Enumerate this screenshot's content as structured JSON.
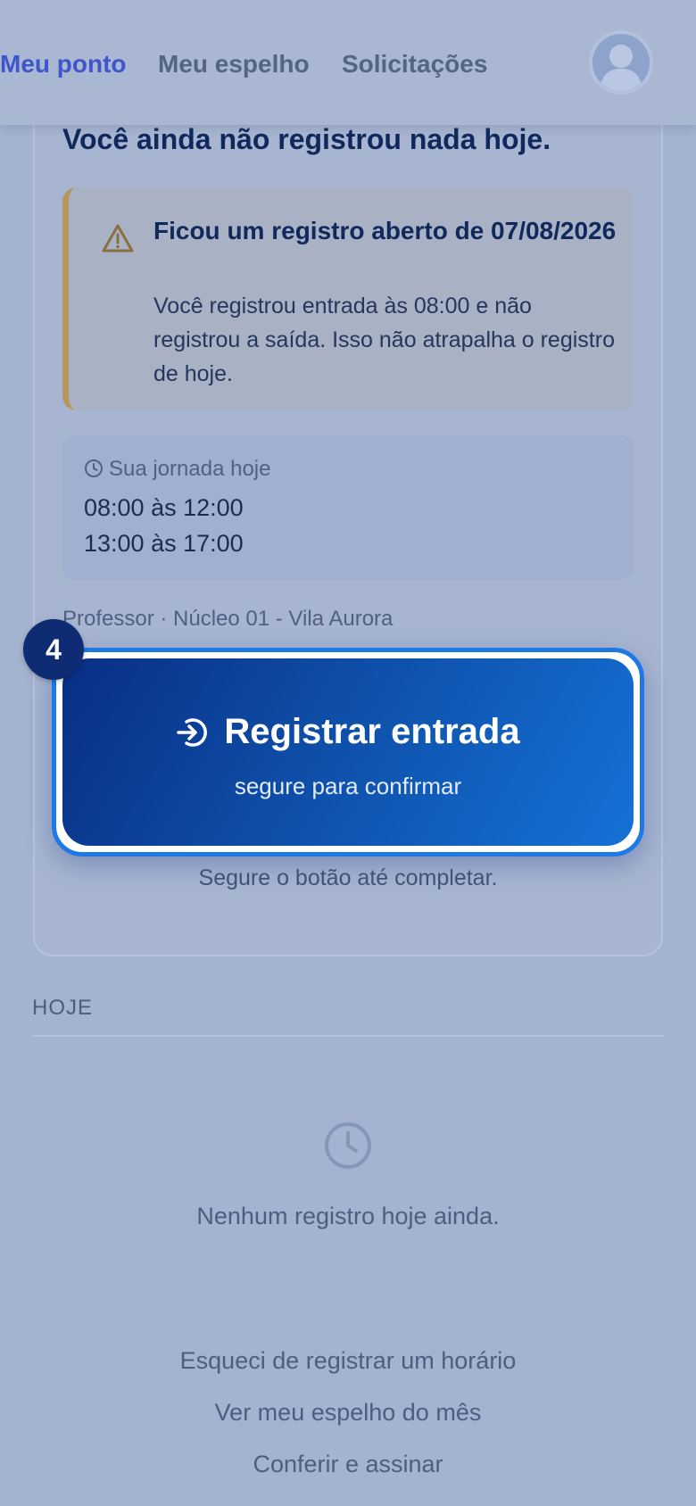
{
  "nav": {
    "tabs": [
      "Meu ponto",
      "Meu espelho",
      "Solicitações"
    ],
    "active_tab": "Meu ponto"
  },
  "card": {
    "title": "Você ainda não registrou nada hoje.",
    "warning": {
      "title": "Ficou um registro aberto de 07/08/2026",
      "text": "Você registrou entrada às 08:00 e não registrou a saída. Isso não atrapalha o registro de hoje.",
      "icon": "warning-triangle-icon"
    },
    "shift": {
      "heading": "Sua jornada hoje",
      "icon": "clock-icon",
      "periods": [
        "08:00 às 12:00",
        "13:00 às 17:00"
      ]
    },
    "role_line": "Professor · Núcleo 01 - Vila Aurora",
    "button": {
      "label": "Registrar entrada",
      "sublabel": "segure para confirmar",
      "icon": "sign-in-icon"
    },
    "step_badge": "4",
    "hold_hint": "Segure o botão até completar."
  },
  "today": {
    "section_label": "HOJE",
    "empty_text": "Nenhum registro hoje ainda.",
    "empty_icon": "clock-icon"
  },
  "footer_links": [
    "Esqueci de registrar um horário",
    "Ver meu espelho do mês",
    "Conferir e assinar"
  ],
  "colors": {
    "accent": "#3f55cc",
    "primary_dark": "#0a2e84",
    "primary_light": "#1572d6",
    "warning_border": "#b8955a"
  }
}
